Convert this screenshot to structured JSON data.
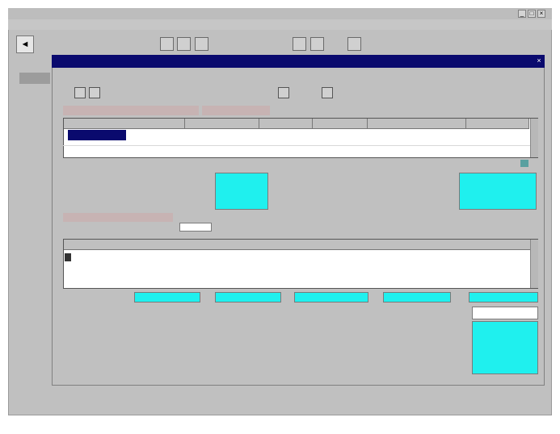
{
  "outer_window": {
    "title": "",
    "menu": [
      "",
      "",
      "",
      "",
      ""
    ],
    "controls": {
      "minimize": "_",
      "maximize": "□",
      "close": "×"
    }
  },
  "toolbar": {
    "buttons": [
      "",
      "",
      "",
      "",
      ""
    ],
    "nav_glyph": "◄"
  },
  "side_tabs": [
    "",
    "",
    ""
  ],
  "inner_window": {
    "title": "",
    "close": "×",
    "menu": [
      "",
      "",
      "",
      "",
      ""
    ],
    "tool_buttons": [
      "",
      "",
      "",
      ""
    ]
  },
  "tabs": [
    "",
    ""
  ],
  "grid1": {
    "columns": [
      "",
      "",
      "",
      "",
      "",
      ""
    ],
    "rows": [
      [
        "",
        "",
        "",
        "",
        "",
        ""
      ]
    ]
  },
  "section_label": "",
  "form": {
    "left_labels": [
      "",
      "",
      ""
    ],
    "right_labels": [
      "",
      "",
      ""
    ],
    "red_label": "",
    "small_field_label": "",
    "small_field_value": ""
  },
  "grid2": {
    "header": "",
    "rows": [
      ""
    ]
  },
  "bottom": {
    "row_label": "",
    "labels": [
      "",
      "",
      "",
      "",
      ""
    ]
  },
  "colors": {
    "window_bg": "#c0c0c0",
    "title_active": "#0a0a6e",
    "field_cyan": "#1ff0ee",
    "red_tab": "#a30000"
  },
  "status_text": ""
}
